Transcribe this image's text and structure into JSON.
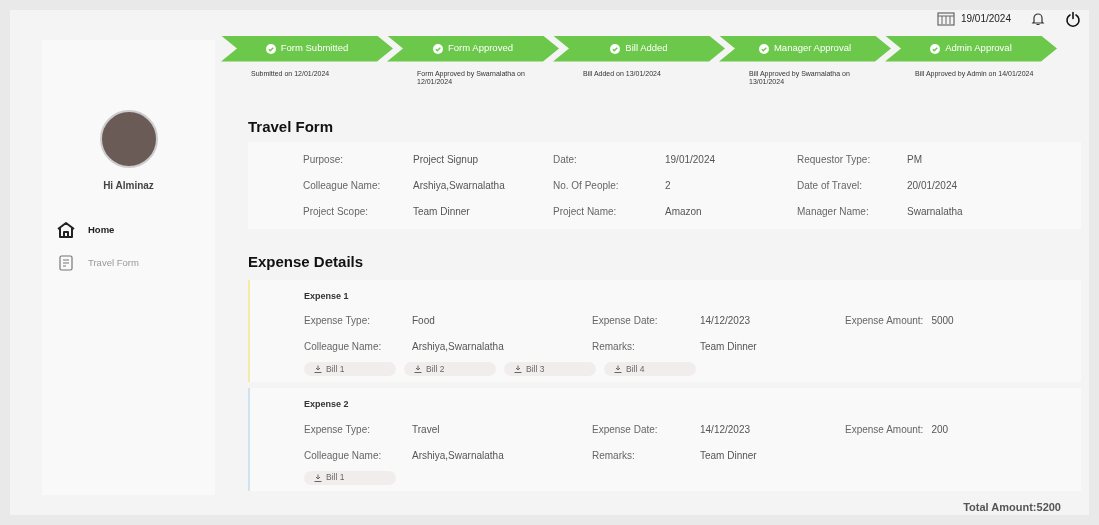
{
  "header": {
    "date": "19/01/2024"
  },
  "sidebar": {
    "greeting": "Hi Alminaz",
    "items": [
      {
        "label": "Home",
        "selected": true,
        "kind": "home"
      },
      {
        "label": "Travel Form",
        "selected": false,
        "kind": "form"
      }
    ]
  },
  "steps": [
    {
      "label": "Form Submitted",
      "completed": true,
      "caption": "Submitted on 12/01/2024"
    },
    {
      "label": "Form Approved",
      "completed": true,
      "caption": "Form Approved by Swarnalatha on 12/01/2024"
    },
    {
      "label": "Bill Added",
      "completed": true,
      "caption": "Bill Added on 13/01/2024"
    },
    {
      "label": "Manager Approval",
      "completed": true,
      "caption": "Bill Approved by Swarnalatha on 13/01/2024"
    },
    {
      "label": "Admin Approval",
      "completed": true,
      "caption": "Bill Approved by Admin on 14/01/2024"
    }
  ],
  "travel_form": {
    "title": "Travel Form",
    "fields": [
      {
        "label": "Purpose:",
        "value": "Project Signup"
      },
      {
        "label": "Date:",
        "value": "19/01/2024"
      },
      {
        "label": "Requestor Type:",
        "value": "PM"
      },
      {
        "label": "Colleague Name:",
        "value": "Arshiya,Swarnalatha"
      },
      {
        "label": "No. Of People:",
        "value": "2"
      },
      {
        "label": "Date of Travel:",
        "value": "20/01/2024"
      },
      {
        "label": "Project Scope:",
        "value": "Team Dinner"
      },
      {
        "label": "Project Name:",
        "value": "Amazon"
      },
      {
        "label": "Manager Name:",
        "value": "Swarnalatha"
      }
    ]
  },
  "expense_details": {
    "title": "Expense Details",
    "expenses": [
      {
        "title": "Expense 1",
        "color": "#f5eba8",
        "fields": [
          {
            "label": "Expense Type:",
            "value": "Food"
          },
          {
            "label": "Expense Date:",
            "value": "14/12/2023"
          },
          {
            "label": "Expense Amount:",
            "value": "5000"
          },
          {
            "label": "Colleague Name:",
            "value": "Arshiya,Swarnalatha"
          },
          {
            "label": "Remarks:",
            "value": "Team Dinner"
          }
        ],
        "bills": [
          "Bill 1",
          "Bill 2",
          "Bill 3",
          "Bill 4"
        ]
      },
      {
        "title": "Expense 2",
        "color": "#cfe2f0",
        "fields": [
          {
            "label": "Expense Type:",
            "value": "Travel"
          },
          {
            "label": "Expense Date:",
            "value": "14/12/2023"
          },
          {
            "label": "Expense Amount:",
            "value": "200"
          },
          {
            "label": "Colleague Name:",
            "value": "Arshiya,Swarnalatha"
          },
          {
            "label": "Remarks:",
            "value": "Team Dinner"
          }
        ],
        "bills": [
          "Bill 1"
        ]
      }
    ],
    "total": "Total Amount:5200"
  }
}
